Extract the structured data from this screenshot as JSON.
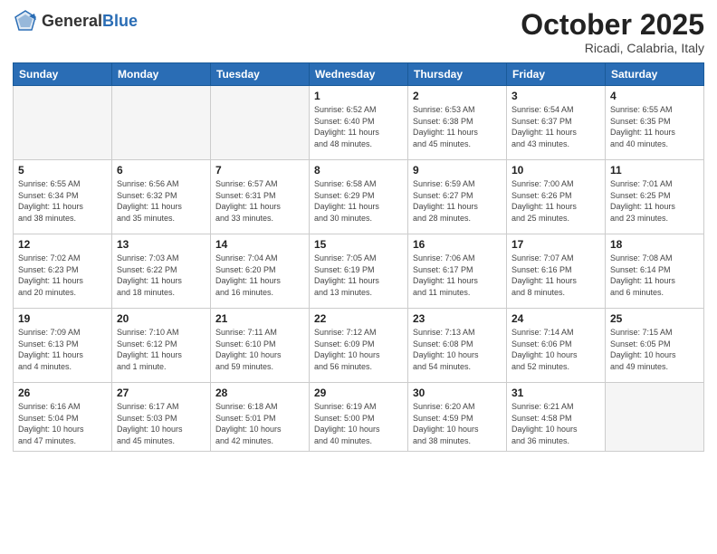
{
  "header": {
    "logo_general": "General",
    "logo_blue": "Blue",
    "month_title": "October 2025",
    "location": "Ricadi, Calabria, Italy"
  },
  "weekdays": [
    "Sunday",
    "Monday",
    "Tuesday",
    "Wednesday",
    "Thursday",
    "Friday",
    "Saturday"
  ],
  "weeks": [
    [
      {
        "day": "",
        "info": ""
      },
      {
        "day": "",
        "info": ""
      },
      {
        "day": "",
        "info": ""
      },
      {
        "day": "1",
        "info": "Sunrise: 6:52 AM\nSunset: 6:40 PM\nDaylight: 11 hours\nand 48 minutes."
      },
      {
        "day": "2",
        "info": "Sunrise: 6:53 AM\nSunset: 6:38 PM\nDaylight: 11 hours\nand 45 minutes."
      },
      {
        "day": "3",
        "info": "Sunrise: 6:54 AM\nSunset: 6:37 PM\nDaylight: 11 hours\nand 43 minutes."
      },
      {
        "day": "4",
        "info": "Sunrise: 6:55 AM\nSunset: 6:35 PM\nDaylight: 11 hours\nand 40 minutes."
      }
    ],
    [
      {
        "day": "5",
        "info": "Sunrise: 6:55 AM\nSunset: 6:34 PM\nDaylight: 11 hours\nand 38 minutes."
      },
      {
        "day": "6",
        "info": "Sunrise: 6:56 AM\nSunset: 6:32 PM\nDaylight: 11 hours\nand 35 minutes."
      },
      {
        "day": "7",
        "info": "Sunrise: 6:57 AM\nSunset: 6:31 PM\nDaylight: 11 hours\nand 33 minutes."
      },
      {
        "day": "8",
        "info": "Sunrise: 6:58 AM\nSunset: 6:29 PM\nDaylight: 11 hours\nand 30 minutes."
      },
      {
        "day": "9",
        "info": "Sunrise: 6:59 AM\nSunset: 6:27 PM\nDaylight: 11 hours\nand 28 minutes."
      },
      {
        "day": "10",
        "info": "Sunrise: 7:00 AM\nSunset: 6:26 PM\nDaylight: 11 hours\nand 25 minutes."
      },
      {
        "day": "11",
        "info": "Sunrise: 7:01 AM\nSunset: 6:25 PM\nDaylight: 11 hours\nand 23 minutes."
      }
    ],
    [
      {
        "day": "12",
        "info": "Sunrise: 7:02 AM\nSunset: 6:23 PM\nDaylight: 11 hours\nand 20 minutes."
      },
      {
        "day": "13",
        "info": "Sunrise: 7:03 AM\nSunset: 6:22 PM\nDaylight: 11 hours\nand 18 minutes."
      },
      {
        "day": "14",
        "info": "Sunrise: 7:04 AM\nSunset: 6:20 PM\nDaylight: 11 hours\nand 16 minutes."
      },
      {
        "day": "15",
        "info": "Sunrise: 7:05 AM\nSunset: 6:19 PM\nDaylight: 11 hours\nand 13 minutes."
      },
      {
        "day": "16",
        "info": "Sunrise: 7:06 AM\nSunset: 6:17 PM\nDaylight: 11 hours\nand 11 minutes."
      },
      {
        "day": "17",
        "info": "Sunrise: 7:07 AM\nSunset: 6:16 PM\nDaylight: 11 hours\nand 8 minutes."
      },
      {
        "day": "18",
        "info": "Sunrise: 7:08 AM\nSunset: 6:14 PM\nDaylight: 11 hours\nand 6 minutes."
      }
    ],
    [
      {
        "day": "19",
        "info": "Sunrise: 7:09 AM\nSunset: 6:13 PM\nDaylight: 11 hours\nand 4 minutes."
      },
      {
        "day": "20",
        "info": "Sunrise: 7:10 AM\nSunset: 6:12 PM\nDaylight: 11 hours\nand 1 minute."
      },
      {
        "day": "21",
        "info": "Sunrise: 7:11 AM\nSunset: 6:10 PM\nDaylight: 10 hours\nand 59 minutes."
      },
      {
        "day": "22",
        "info": "Sunrise: 7:12 AM\nSunset: 6:09 PM\nDaylight: 10 hours\nand 56 minutes."
      },
      {
        "day": "23",
        "info": "Sunrise: 7:13 AM\nSunset: 6:08 PM\nDaylight: 10 hours\nand 54 minutes."
      },
      {
        "day": "24",
        "info": "Sunrise: 7:14 AM\nSunset: 6:06 PM\nDaylight: 10 hours\nand 52 minutes."
      },
      {
        "day": "25",
        "info": "Sunrise: 7:15 AM\nSunset: 6:05 PM\nDaylight: 10 hours\nand 49 minutes."
      }
    ],
    [
      {
        "day": "26",
        "info": "Sunrise: 6:16 AM\nSunset: 5:04 PM\nDaylight: 10 hours\nand 47 minutes."
      },
      {
        "day": "27",
        "info": "Sunrise: 6:17 AM\nSunset: 5:03 PM\nDaylight: 10 hours\nand 45 minutes."
      },
      {
        "day": "28",
        "info": "Sunrise: 6:18 AM\nSunset: 5:01 PM\nDaylight: 10 hours\nand 42 minutes."
      },
      {
        "day": "29",
        "info": "Sunrise: 6:19 AM\nSunset: 5:00 PM\nDaylight: 10 hours\nand 40 minutes."
      },
      {
        "day": "30",
        "info": "Sunrise: 6:20 AM\nSunset: 4:59 PM\nDaylight: 10 hours\nand 38 minutes."
      },
      {
        "day": "31",
        "info": "Sunrise: 6:21 AM\nSunset: 4:58 PM\nDaylight: 10 hours\nand 36 minutes."
      },
      {
        "day": "",
        "info": ""
      }
    ]
  ]
}
